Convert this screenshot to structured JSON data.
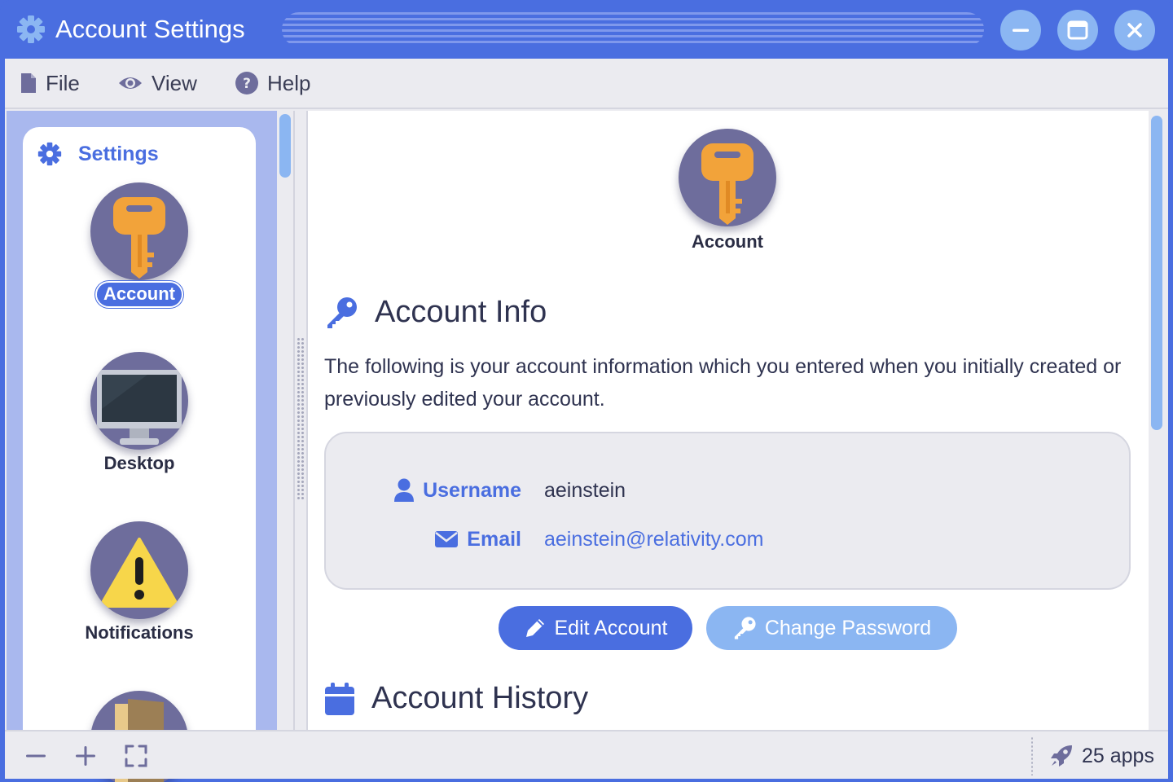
{
  "window": {
    "title": "Account Settings",
    "icon": "gear-icon",
    "controls": [
      "minimize-icon",
      "maximize-icon",
      "close-icon"
    ],
    "accent_color": "#4a6ee0",
    "light_accent_color": "#8bb6f2"
  },
  "menu": {
    "items": [
      {
        "label": "File",
        "icon": "file-icon"
      },
      {
        "label": "View",
        "icon": "eye-icon"
      },
      {
        "label": "Help",
        "icon": "question-circle-icon"
      }
    ]
  },
  "sidebar": {
    "heading": "Settings",
    "heading_icon": "gear-icon",
    "items": [
      {
        "label": "Account",
        "icon": "key-icon",
        "active": true
      },
      {
        "label": "Desktop",
        "icon": "monitor-icon",
        "active": false
      },
      {
        "label": "Notifications",
        "icon": "warning-icon",
        "active": false
      },
      {
        "label": "",
        "icon": "door-icon",
        "active": false
      }
    ]
  },
  "main": {
    "hero_label": "Account",
    "hero_icon": "key-icon",
    "account_info": {
      "heading": "Account Info",
      "description": "The following is your account information which you entered when you initially created or previously edited your account.",
      "fields": [
        {
          "label": "Username",
          "icon": "user-icon",
          "value": "aeinstein"
        },
        {
          "label": "Email",
          "icon": "envelope-icon",
          "value": "aeinstein@relativity.com"
        }
      ]
    },
    "buttons": {
      "edit": "Edit Account",
      "change_password": "Change Password"
    },
    "account_history": {
      "heading": "Account History",
      "icon": "calendar-icon"
    }
  },
  "statusbar": {
    "zoom_controls": [
      "zoom-out-icon",
      "zoom-in-icon",
      "fullscreen-icon"
    ],
    "apps_count": "25 apps",
    "apps_icon": "rocket-icon"
  }
}
